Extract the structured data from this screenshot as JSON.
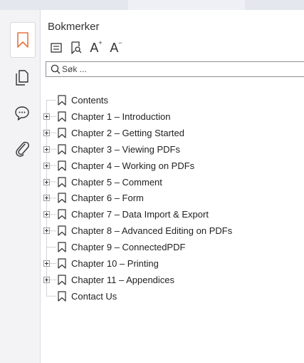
{
  "panel": {
    "title": "Bokmerker"
  },
  "toolbar": {
    "buttons": [
      {
        "name": "expand-all-icon"
      },
      {
        "name": "add-bookmark-icon"
      },
      {
        "name": "font-increase-icon",
        "glyph": "A",
        "mark": "+"
      },
      {
        "name": "font-decrease-icon",
        "glyph": "A",
        "mark": "−"
      }
    ]
  },
  "search": {
    "placeholder": "Søk ..."
  },
  "rail": {
    "items": [
      {
        "name": "bookmarks-icon",
        "active": true
      },
      {
        "name": "pages-icon",
        "active": false
      },
      {
        "name": "comments-icon",
        "active": false
      },
      {
        "name": "attachments-icon",
        "active": false
      }
    ]
  },
  "bookmarks": [
    {
      "label": "Contents",
      "expandable": false
    },
    {
      "label": "Chapter 1 – Introduction",
      "expandable": true
    },
    {
      "label": "Chapter 2 – Getting Started",
      "expandable": true
    },
    {
      "label": "Chapter 3 – Viewing PDFs",
      "expandable": true
    },
    {
      "label": "Chapter 4 – Working on PDFs",
      "expandable": true
    },
    {
      "label": "Chapter 5 – Comment",
      "expandable": true
    },
    {
      "label": "Chapter 6 – Form",
      "expandable": true
    },
    {
      "label": "Chapter 7 – Data Import & Export",
      "expandable": true
    },
    {
      "label": "Chapter 8 – Advanced Editing on PDFs",
      "expandable": true
    },
    {
      "label": "Chapter 9 – ConnectedPDF",
      "expandable": false
    },
    {
      "label": "Chapter 10 – Printing",
      "expandable": true
    },
    {
      "label": "Chapter 11 – Appendices",
      "expandable": true
    },
    {
      "label": "Contact Us",
      "expandable": false
    }
  ],
  "colors": {
    "accent": "#e8743b",
    "rail_bg": "#f3f3f6",
    "icon": "#333333"
  }
}
